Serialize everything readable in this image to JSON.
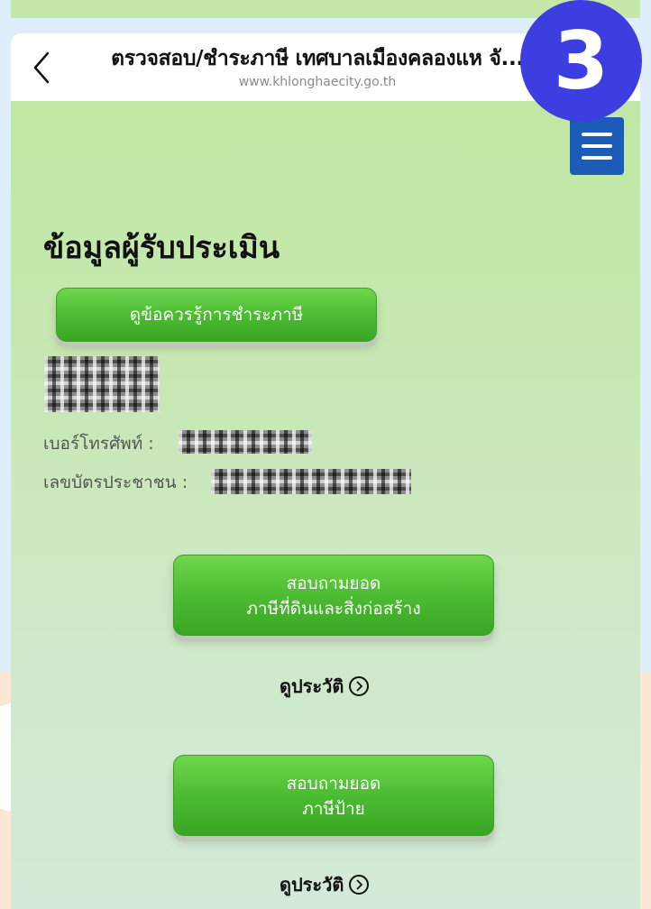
{
  "step_badge": "3",
  "navbar": {
    "title": "ตรวจสอบ/ชำระภาษี เทศบาลเมืองคลองแห จั...",
    "url": "www.khlonghaecity.go.th"
  },
  "page": {
    "heading": "ข้อมูลผู้รับประเมิน",
    "knowledge_button": "ดูข้อควรรู้การชำระภาษี",
    "phone_label": "เบอร์โทรศัพท์ :",
    "id_label": "เลขบัตรประชาชน :"
  },
  "actions": [
    {
      "line1": "สอบถามยอด",
      "line2": "ภาษีที่ดินและสิ่งก่อสร้าง",
      "history": "ดูประวัติ"
    },
    {
      "line1": "สอบถามยอด",
      "line2": "ภาษีป้าย",
      "history": "ดูประวัติ"
    }
  ],
  "colors": {
    "button_green": "#4cbc32",
    "badge_blue": "#3d3ee0",
    "menu_blue": "#1c5cb8"
  },
  "icons": [
    "back-chevron-icon",
    "menu-icon",
    "chevron-right-circle-icon"
  ]
}
